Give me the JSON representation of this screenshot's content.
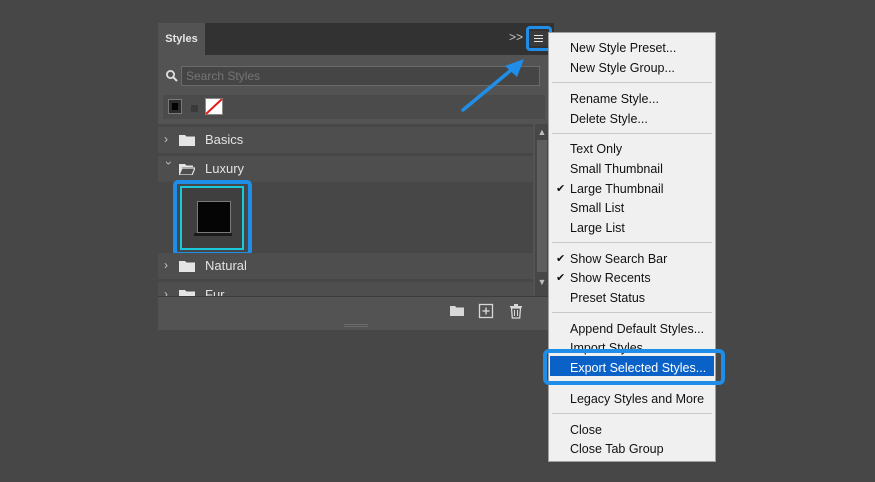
{
  "panel": {
    "tab_label": "Styles",
    "collapse_glyph": ">>",
    "search_placeholder": "Search Styles",
    "folders": [
      {
        "label": "Basics",
        "expanded": false
      },
      {
        "label": "Luxury",
        "expanded": true
      },
      {
        "label": "Natural",
        "expanded": false
      },
      {
        "label": "Fur",
        "expanded": false
      }
    ]
  },
  "menu": {
    "items": [
      {
        "label": "New Style Preset..."
      },
      {
        "label": "New Style Group..."
      },
      {
        "label": "Rename Style..."
      },
      {
        "label": "Delete Style..."
      },
      {
        "label": "Text Only"
      },
      {
        "label": "Small Thumbnail"
      },
      {
        "label": "Large Thumbnail",
        "checked": true
      },
      {
        "label": "Small List"
      },
      {
        "label": "Large List"
      },
      {
        "label": "Show Search Bar",
        "checked": true
      },
      {
        "label": "Show Recents",
        "checked": true
      },
      {
        "label": "Preset Status"
      },
      {
        "label": "Append Default Styles..."
      },
      {
        "label": "Import Styles..."
      },
      {
        "label": "Export Selected Styles...",
        "highlighted": true
      },
      {
        "label": "Legacy Styles and More"
      },
      {
        "label": "Close"
      },
      {
        "label": "Close Tab Group"
      }
    ],
    "check_glyph": "✔"
  },
  "colors": {
    "accent": "#1e8ee8",
    "menu_highlight": "#0a62c9"
  }
}
